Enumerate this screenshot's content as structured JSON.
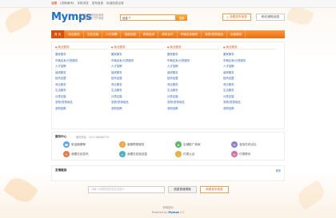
{
  "topbar": {
    "city": "北京",
    "links": [
      "[切换城市]",
      "手机浏览",
      "发布信息",
      "标准信息目录"
    ]
  },
  "header": {
    "logo": "Mymps",
    "tagline_1": "网站分类信息系统",
    "tagline_2": "网站地方门户系统",
    "search_select": "信息",
    "search_button": "搜索",
    "post_button": "免费发布信息",
    "edit_button": "修改/删除信息"
  },
  "nav": [
    "首 页",
    "商业服务",
    "交友征婚",
    "人才招聘",
    "招商加盟",
    "教育培训",
    "商务合作",
    "车辆买卖服务",
    "宠物/宠物用品",
    "出租服务"
  ],
  "categories": [
    {
      "title": "商业服务",
      "items": [
        "搬家服务",
        "车辆买卖/分类服务",
        "人才招聘",
        "装修服务",
        "招商加盟",
        "商业服务",
        "生活服务",
        "分类征婚",
        "宠物/宠物用品",
        "求职招聘"
      ]
    },
    {
      "title": "商业服务",
      "items": [
        "搬家服务",
        "车辆买卖/分类服务",
        "人才招聘",
        "装修服务",
        "招商加盟",
        "商业服务",
        "生活服务",
        "分类征婚",
        "宠物/宠物用品",
        "求职招聘"
      ]
    },
    {
      "title": "商业服务",
      "items": [
        "搬家服务",
        "车辆买卖/分类服务",
        "人才招聘",
        "装修服务",
        "招商加盟",
        "商业服务",
        "生活服务",
        "分类征婚",
        "宠物/宠物用品",
        "求职招聘"
      ]
    },
    {
      "title": "商业服务",
      "items": [
        "搬家服务",
        "车辆买卖/分类服务",
        "人才招聘",
        "装修服务",
        "招商加盟",
        "商业服务",
        "生活服务",
        "分类征婚",
        "宠物/宠物用品",
        "求职招聘"
      ]
    }
  ],
  "services": {
    "title": "服务中心",
    "subtitle": "服务热线：0371-68088779",
    "items": [
      {
        "label": "电话随便聊",
        "icon": "☎",
        "color": "#5ba4e8"
      },
      {
        "label": "客服帮助服务",
        "icon": "?",
        "color": "#f3a53b"
      },
      {
        "label": "店铺推广商家",
        "icon": "★",
        "color": "#59b86a"
      },
      {
        "label": "漫谈在线论坛",
        "icon": "✉",
        "color": "#8d7ad8"
      },
      {
        "label": "我要在线发布",
        "icon": "✎",
        "color": "#e8784b"
      },
      {
        "label": "我要在线找信息",
        "icon": "⌕",
        "color": "#49b2c6"
      },
      {
        "label": "付费认证",
        "icon": "✓",
        "color": "#e4b33a"
      },
      {
        "label": "付费联系",
        "icon": "☏",
        "color": "#d86aa1"
      }
    ]
  },
  "links": {
    "title": "友情链接",
    "more": "更多"
  },
  "bottom_search": {
    "placeholder": "请输入你要查找的信息关键字",
    "button": "信息快速搜索",
    "post": "免费发布信息"
  },
  "footer": {
    "line1": "本网站为",
    "line2_prefix": "Powered by",
    "brand": "Mymps",
    "version": "2.0"
  }
}
